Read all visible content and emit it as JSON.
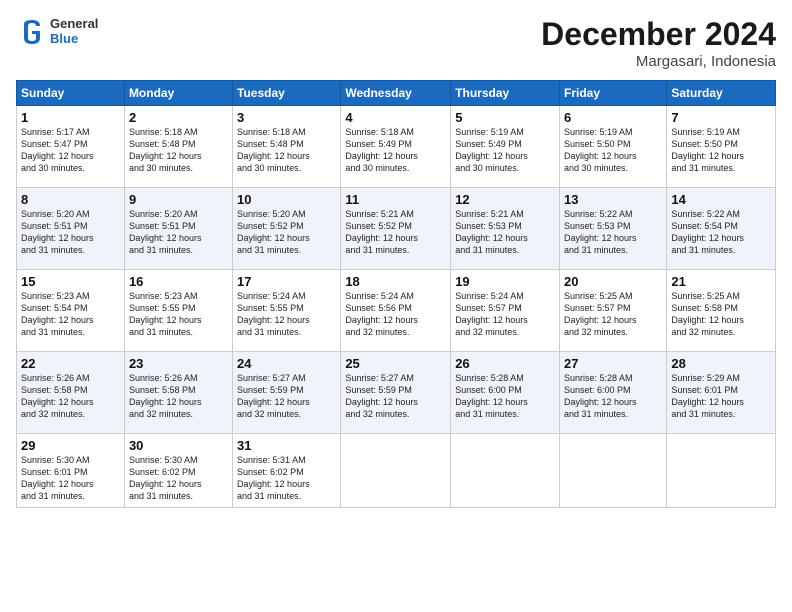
{
  "header": {
    "logo_line1": "General",
    "logo_line2": "Blue",
    "month": "December 2024",
    "location": "Margasari, Indonesia"
  },
  "days_of_week": [
    "Sunday",
    "Monday",
    "Tuesday",
    "Wednesday",
    "Thursday",
    "Friday",
    "Saturday"
  ],
  "weeks": [
    [
      {
        "day": "1",
        "sunrise": "5:17 AM",
        "sunset": "5:47 PM",
        "daylight": "12 hours and 30 minutes."
      },
      {
        "day": "2",
        "sunrise": "5:18 AM",
        "sunset": "5:48 PM",
        "daylight": "12 hours and 30 minutes."
      },
      {
        "day": "3",
        "sunrise": "5:18 AM",
        "sunset": "5:48 PM",
        "daylight": "12 hours and 30 minutes."
      },
      {
        "day": "4",
        "sunrise": "5:18 AM",
        "sunset": "5:49 PM",
        "daylight": "12 hours and 30 minutes."
      },
      {
        "day": "5",
        "sunrise": "5:19 AM",
        "sunset": "5:49 PM",
        "daylight": "12 hours and 30 minutes."
      },
      {
        "day": "6",
        "sunrise": "5:19 AM",
        "sunset": "5:50 PM",
        "daylight": "12 hours and 30 minutes."
      },
      {
        "day": "7",
        "sunrise": "5:19 AM",
        "sunset": "5:50 PM",
        "daylight": "12 hours and 31 minutes."
      }
    ],
    [
      {
        "day": "8",
        "sunrise": "5:20 AM",
        "sunset": "5:51 PM",
        "daylight": "12 hours and 31 minutes."
      },
      {
        "day": "9",
        "sunrise": "5:20 AM",
        "sunset": "5:51 PM",
        "daylight": "12 hours and 31 minutes."
      },
      {
        "day": "10",
        "sunrise": "5:20 AM",
        "sunset": "5:52 PM",
        "daylight": "12 hours and 31 minutes."
      },
      {
        "day": "11",
        "sunrise": "5:21 AM",
        "sunset": "5:52 PM",
        "daylight": "12 hours and 31 minutes."
      },
      {
        "day": "12",
        "sunrise": "5:21 AM",
        "sunset": "5:53 PM",
        "daylight": "12 hours and 31 minutes."
      },
      {
        "day": "13",
        "sunrise": "5:22 AM",
        "sunset": "5:53 PM",
        "daylight": "12 hours and 31 minutes."
      },
      {
        "day": "14",
        "sunrise": "5:22 AM",
        "sunset": "5:54 PM",
        "daylight": "12 hours and 31 minutes."
      }
    ],
    [
      {
        "day": "15",
        "sunrise": "5:23 AM",
        "sunset": "5:54 PM",
        "daylight": "12 hours and 31 minutes."
      },
      {
        "day": "16",
        "sunrise": "5:23 AM",
        "sunset": "5:55 PM",
        "daylight": "12 hours and 31 minutes."
      },
      {
        "day": "17",
        "sunrise": "5:24 AM",
        "sunset": "5:55 PM",
        "daylight": "12 hours and 31 minutes."
      },
      {
        "day": "18",
        "sunrise": "5:24 AM",
        "sunset": "5:56 PM",
        "daylight": "12 hours and 32 minutes."
      },
      {
        "day": "19",
        "sunrise": "5:24 AM",
        "sunset": "5:57 PM",
        "daylight": "12 hours and 32 minutes."
      },
      {
        "day": "20",
        "sunrise": "5:25 AM",
        "sunset": "5:57 PM",
        "daylight": "12 hours and 32 minutes."
      },
      {
        "day": "21",
        "sunrise": "5:25 AM",
        "sunset": "5:58 PM",
        "daylight": "12 hours and 32 minutes."
      }
    ],
    [
      {
        "day": "22",
        "sunrise": "5:26 AM",
        "sunset": "5:58 PM",
        "daylight": "12 hours and 32 minutes."
      },
      {
        "day": "23",
        "sunrise": "5:26 AM",
        "sunset": "5:58 PM",
        "daylight": "12 hours and 32 minutes."
      },
      {
        "day": "24",
        "sunrise": "5:27 AM",
        "sunset": "5:59 PM",
        "daylight": "12 hours and 32 minutes."
      },
      {
        "day": "25",
        "sunrise": "5:27 AM",
        "sunset": "5:59 PM",
        "daylight": "12 hours and 32 minutes."
      },
      {
        "day": "26",
        "sunrise": "5:28 AM",
        "sunset": "6:00 PM",
        "daylight": "12 hours and 31 minutes."
      },
      {
        "day": "27",
        "sunrise": "5:28 AM",
        "sunset": "6:00 PM",
        "daylight": "12 hours and 31 minutes."
      },
      {
        "day": "28",
        "sunrise": "5:29 AM",
        "sunset": "6:01 PM",
        "daylight": "12 hours and 31 minutes."
      }
    ],
    [
      {
        "day": "29",
        "sunrise": "5:30 AM",
        "sunset": "6:01 PM",
        "daylight": "12 hours and 31 minutes."
      },
      {
        "day": "30",
        "sunrise": "5:30 AM",
        "sunset": "6:02 PM",
        "daylight": "12 hours and 31 minutes."
      },
      {
        "day": "31",
        "sunrise": "5:31 AM",
        "sunset": "6:02 PM",
        "daylight": "12 hours and 31 minutes."
      },
      null,
      null,
      null,
      null
    ]
  ],
  "labels": {
    "sunrise": "Sunrise:",
    "sunset": "Sunset:",
    "daylight": "Daylight:"
  }
}
